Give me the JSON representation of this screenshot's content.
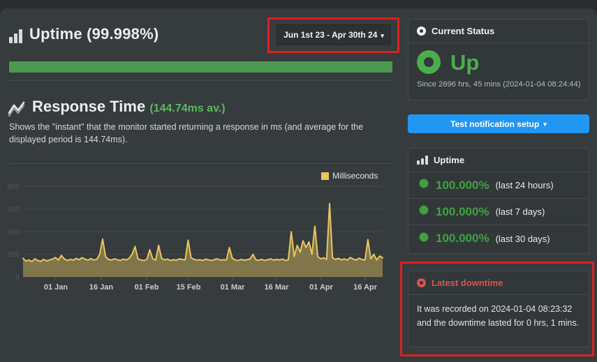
{
  "header": {
    "title": "Uptime (99.998%)",
    "date_range": "Jun 1st 23 - Apr 30th 24",
    "caret": "▾"
  },
  "response_time": {
    "title": "Response Time",
    "average": "(144.74ms av.)",
    "description": "Shows the \"instant\" that the monitor started returning a response in ms (and average for the displayed period is 144.74ms)."
  },
  "chart_data": {
    "type": "area",
    "title": "Response Time",
    "legend": [
      "Milliseconds"
    ],
    "legend_position": "top-right",
    "x_tick_labels": [
      "01 Jan",
      "16 Jan",
      "01 Feb",
      "15 Feb",
      "01 Mar",
      "16 Mar",
      "01 Apr",
      "16 Apr"
    ],
    "y_ticks": [
      0,
      200,
      400,
      600,
      800
    ],
    "ylim": [
      0,
      880
    ],
    "grid": true,
    "series": [
      {
        "name": "Milliseconds",
        "color": "#e8c55e",
        "start": "~21 Dec, daily samples",
        "values": [
          165,
          140,
          150,
          135,
          160,
          145,
          138,
          155,
          142,
          150,
          158,
          172,
          150,
          190,
          160,
          145,
          155,
          148,
          165,
          152,
          170,
          158,
          148,
          162,
          150,
          155,
          200,
          335,
          180,
          155,
          148,
          160,
          152,
          145,
          158,
          150,
          165,
          200,
          270,
          160,
          150,
          145,
          155,
          240,
          160,
          150,
          280,
          165,
          150,
          158,
          145,
          152,
          148,
          160,
          155,
          150,
          325,
          170,
          155,
          148,
          152,
          145,
          158,
          150,
          146,
          155,
          160,
          148,
          152,
          150,
          260,
          165,
          150,
          145,
          155,
          148,
          152,
          158,
          200,
          150,
          148,
          155,
          145,
          152,
          160,
          148,
          155,
          150,
          158,
          145,
          152,
          400,
          180,
          280,
          220,
          320,
          260,
          310,
          200,
          450,
          180,
          160,
          170,
          155,
          650,
          170,
          155,
          165,
          150,
          160,
          148,
          172,
          158,
          150,
          165,
          155,
          148,
          330,
          160,
          200,
          150,
          185,
          170
        ]
      }
    ]
  },
  "sidebar": {
    "current_status": {
      "title": "Current Status",
      "status": "Up",
      "since": "Since 2696 hrs, 45 mins (2024-01-04 08:24:44)"
    },
    "test_button": {
      "label": "Test notification setup",
      "caret": "▾"
    },
    "uptime_panel": {
      "title": "Uptime",
      "rows": [
        {
          "value": "100.000%",
          "label": "(last 24 hours)"
        },
        {
          "value": "100.000%",
          "label": "(last 7 days)"
        },
        {
          "value": "100.000%",
          "label": "(last 30 days)"
        }
      ]
    },
    "latest_downtime": {
      "title": "Latest downtime",
      "body": "It was recorded on 2024-01-04 08:23:32 and the downtime lasted for 0 hrs, 1 mins."
    }
  },
  "colors": {
    "bar_green": "#4c9a4f",
    "status_green": "#4bad4b",
    "uptime_green": "#3fa23f",
    "gold": "#e8c55e",
    "button_blue": "#2196f3",
    "danger_red": "#d9534f",
    "annotation_red": "#dd2121"
  }
}
